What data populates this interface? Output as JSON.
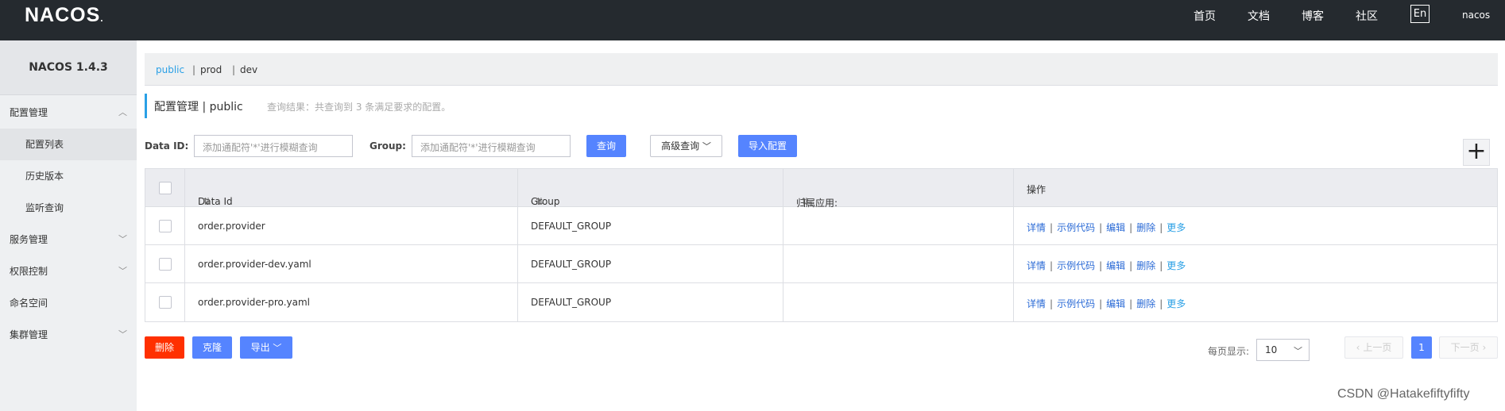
{
  "header": {
    "logo": "NACOS",
    "logo_dot": ".",
    "nav": [
      "首页",
      "文档",
      "博客",
      "社区"
    ],
    "lang": "En",
    "user": "nacos"
  },
  "sidebar": {
    "version": "NACOS 1.4.3",
    "items": [
      {
        "label": "配置管理"
      },
      {
        "label": "配置列表"
      },
      {
        "label": "历史版本"
      },
      {
        "label": "监听查询"
      },
      {
        "label": "服务管理"
      },
      {
        "label": "权限控制"
      },
      {
        "label": "命名空间"
      },
      {
        "label": "集群管理"
      }
    ]
  },
  "namespaces": {
    "items": [
      "public",
      "prod",
      "dev"
    ],
    "sep": "|"
  },
  "page": {
    "title": "配置管理  |  public",
    "result": "查询结果：共查询到 3 条满足要求的配置。"
  },
  "search": {
    "dataid_label": "Data ID:",
    "dataid_placeholder": "添加通配符'*'进行模糊查询",
    "group_label": "Group:",
    "group_placeholder": "添加通配符'*'进行模糊查询",
    "query_button": "查询",
    "advanced_button": "高级查询",
    "import_button": "导入配置"
  },
  "table": {
    "headers": [
      "Data Id",
      "Group",
      "归属应用:",
      "操作"
    ],
    "sort_glyph": "⇅",
    "rows": [
      {
        "data_id": "order.provider",
        "group": "DEFAULT_GROUP",
        "app": ""
      },
      {
        "data_id": "order.provider-dev.yaml",
        "group": "DEFAULT_GROUP",
        "app": ""
      },
      {
        "data_id": "order.provider-pro.yaml",
        "group": "DEFAULT_GROUP",
        "app": ""
      }
    ],
    "ops": [
      "详情",
      "示例代码",
      "编辑",
      "删除",
      "更多"
    ]
  },
  "footer": {
    "delete_button": "删除",
    "clone_button": "克隆",
    "export_button": "导出",
    "page_size_label": "每页显示:",
    "page_size": "10",
    "prev": "上一页",
    "current_page": "1",
    "next": "下一页"
  },
  "watermark": "CSDN @Hatakefiftyfifty",
  "colors": {
    "accent": "#5584ff",
    "danger": "#ff3000",
    "topbar": "#252a2f",
    "link": "#2aa0e6"
  }
}
